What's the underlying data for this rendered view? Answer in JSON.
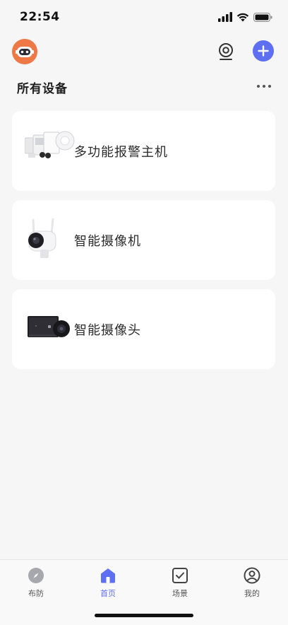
{
  "status_bar": {
    "time": "22:54"
  },
  "header": {
    "avatar_icon": "robot-avatar-icon",
    "camera_icon": "camera-icon",
    "add_icon": "plus-icon",
    "accent_color": "#5f6ff1"
  },
  "section": {
    "title": "所有设备",
    "more_icon": "more-dots-icon"
  },
  "devices": [
    {
      "name": "多功能报警主机",
      "icon": "alarm-host-kit-icon"
    },
    {
      "name": "智能摄像机",
      "icon": "outdoor-camera-icon"
    },
    {
      "name": "智能摄像头",
      "icon": "doorbell-camera-icon"
    }
  ],
  "tab_bar": {
    "tabs": [
      {
        "label": "布防",
        "icon": "compass-icon",
        "active": false
      },
      {
        "label": "首页",
        "icon": "home-icon",
        "active": true
      },
      {
        "label": "场景",
        "icon": "checkbox-icon",
        "active": false
      },
      {
        "label": "我的",
        "icon": "user-icon",
        "active": false
      }
    ]
  }
}
